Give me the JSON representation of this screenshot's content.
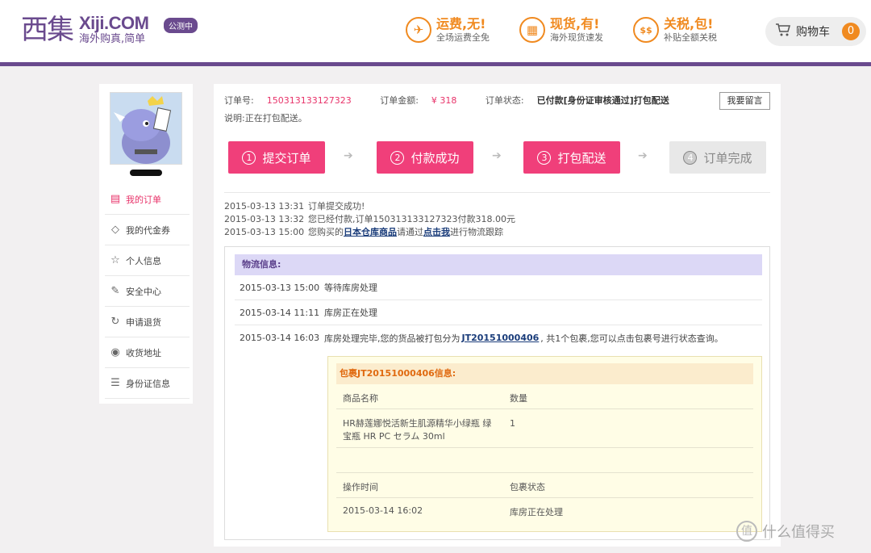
{
  "header": {
    "logo_cn": "西集",
    "logo_en": "Xiji.COM",
    "logo_slogan": "海外购真,简单",
    "beta": "公测中",
    "promos": [
      {
        "icon": "✈",
        "title": "运费,无!",
        "sub": "全场运费全免"
      },
      {
        "icon": "▦",
        "title": "现货,有!",
        "sub": "海外现货速发"
      },
      {
        "icon": "$$",
        "title": "关税,包!",
        "sub": "补贴全额关税"
      }
    ],
    "cart_label": "购物车",
    "cart_count": "0"
  },
  "sidebar": {
    "items": [
      {
        "icon": "▤",
        "label": "我的订单"
      },
      {
        "icon": "◇",
        "label": "我的代金券"
      },
      {
        "icon": "☆",
        "label": "个人信息"
      },
      {
        "icon": "✎",
        "label": "安全中心"
      },
      {
        "icon": "↻",
        "label": "申请退货"
      },
      {
        "icon": "◉",
        "label": "收货地址"
      },
      {
        "icon": "☰",
        "label": "身份证信息"
      }
    ]
  },
  "order": {
    "number_label": "订单号:",
    "number": "150313133127323",
    "amount_label": "订单金额:",
    "amount": "¥ 318",
    "status_label": "订单状态:",
    "status": "已付款[身份证审核通过]打包配送",
    "note": "说明:正在打包配送。",
    "message_button": "我要留言"
  },
  "steps": [
    {
      "num": "1",
      "label": "提交订单"
    },
    {
      "num": "2",
      "label": "付款成功"
    },
    {
      "num": "3",
      "label": "打包配送"
    },
    {
      "num": "4",
      "label": "订单完成"
    }
  ],
  "history": [
    {
      "time": "2015-03-13 13:31",
      "text": "订单提交成功!"
    },
    {
      "time": "2015-03-13 13:32",
      "text": "您已经付款,订单150313133127323付款318.00元"
    },
    {
      "time": "2015-03-13 15:00",
      "pre": "您购买的",
      "link1": "日本仓库商品",
      "mid": "请通过",
      "link2": "点击我",
      "post": "进行物流跟踪"
    }
  ],
  "logistics": {
    "title": "物流信息:",
    "rows": [
      {
        "time": "2015-03-13 15:00",
        "text": "等待库房处理"
      },
      {
        "time": "2015-03-14 11:11",
        "text": "库房正在处理"
      },
      {
        "time": "2015-03-14 16:03",
        "pre": "库房处理完毕,您的货品被打包分为",
        "link": "JT20151000406",
        "post": ", 共1个包裹,您可以点击包裹号进行状态查询。"
      }
    ],
    "package": {
      "title": "包裹JT20151000406信息:",
      "col_product": "商品名称",
      "col_qty": "数量",
      "product_line1": "HR赫莲娜悦活新生肌源精华小绿瓶 绿",
      "product_line2": "宝瓶 HR PC セラム 30ml",
      "qty": "1",
      "col_op_time": "操作时间",
      "col_pkg_status": "包裹状态",
      "op_time": "2015-03-14 16:02",
      "pkg_status": "库房正在处理"
    }
  },
  "watermark": {
    "icon": "值",
    "text": "什么值得买"
  }
}
